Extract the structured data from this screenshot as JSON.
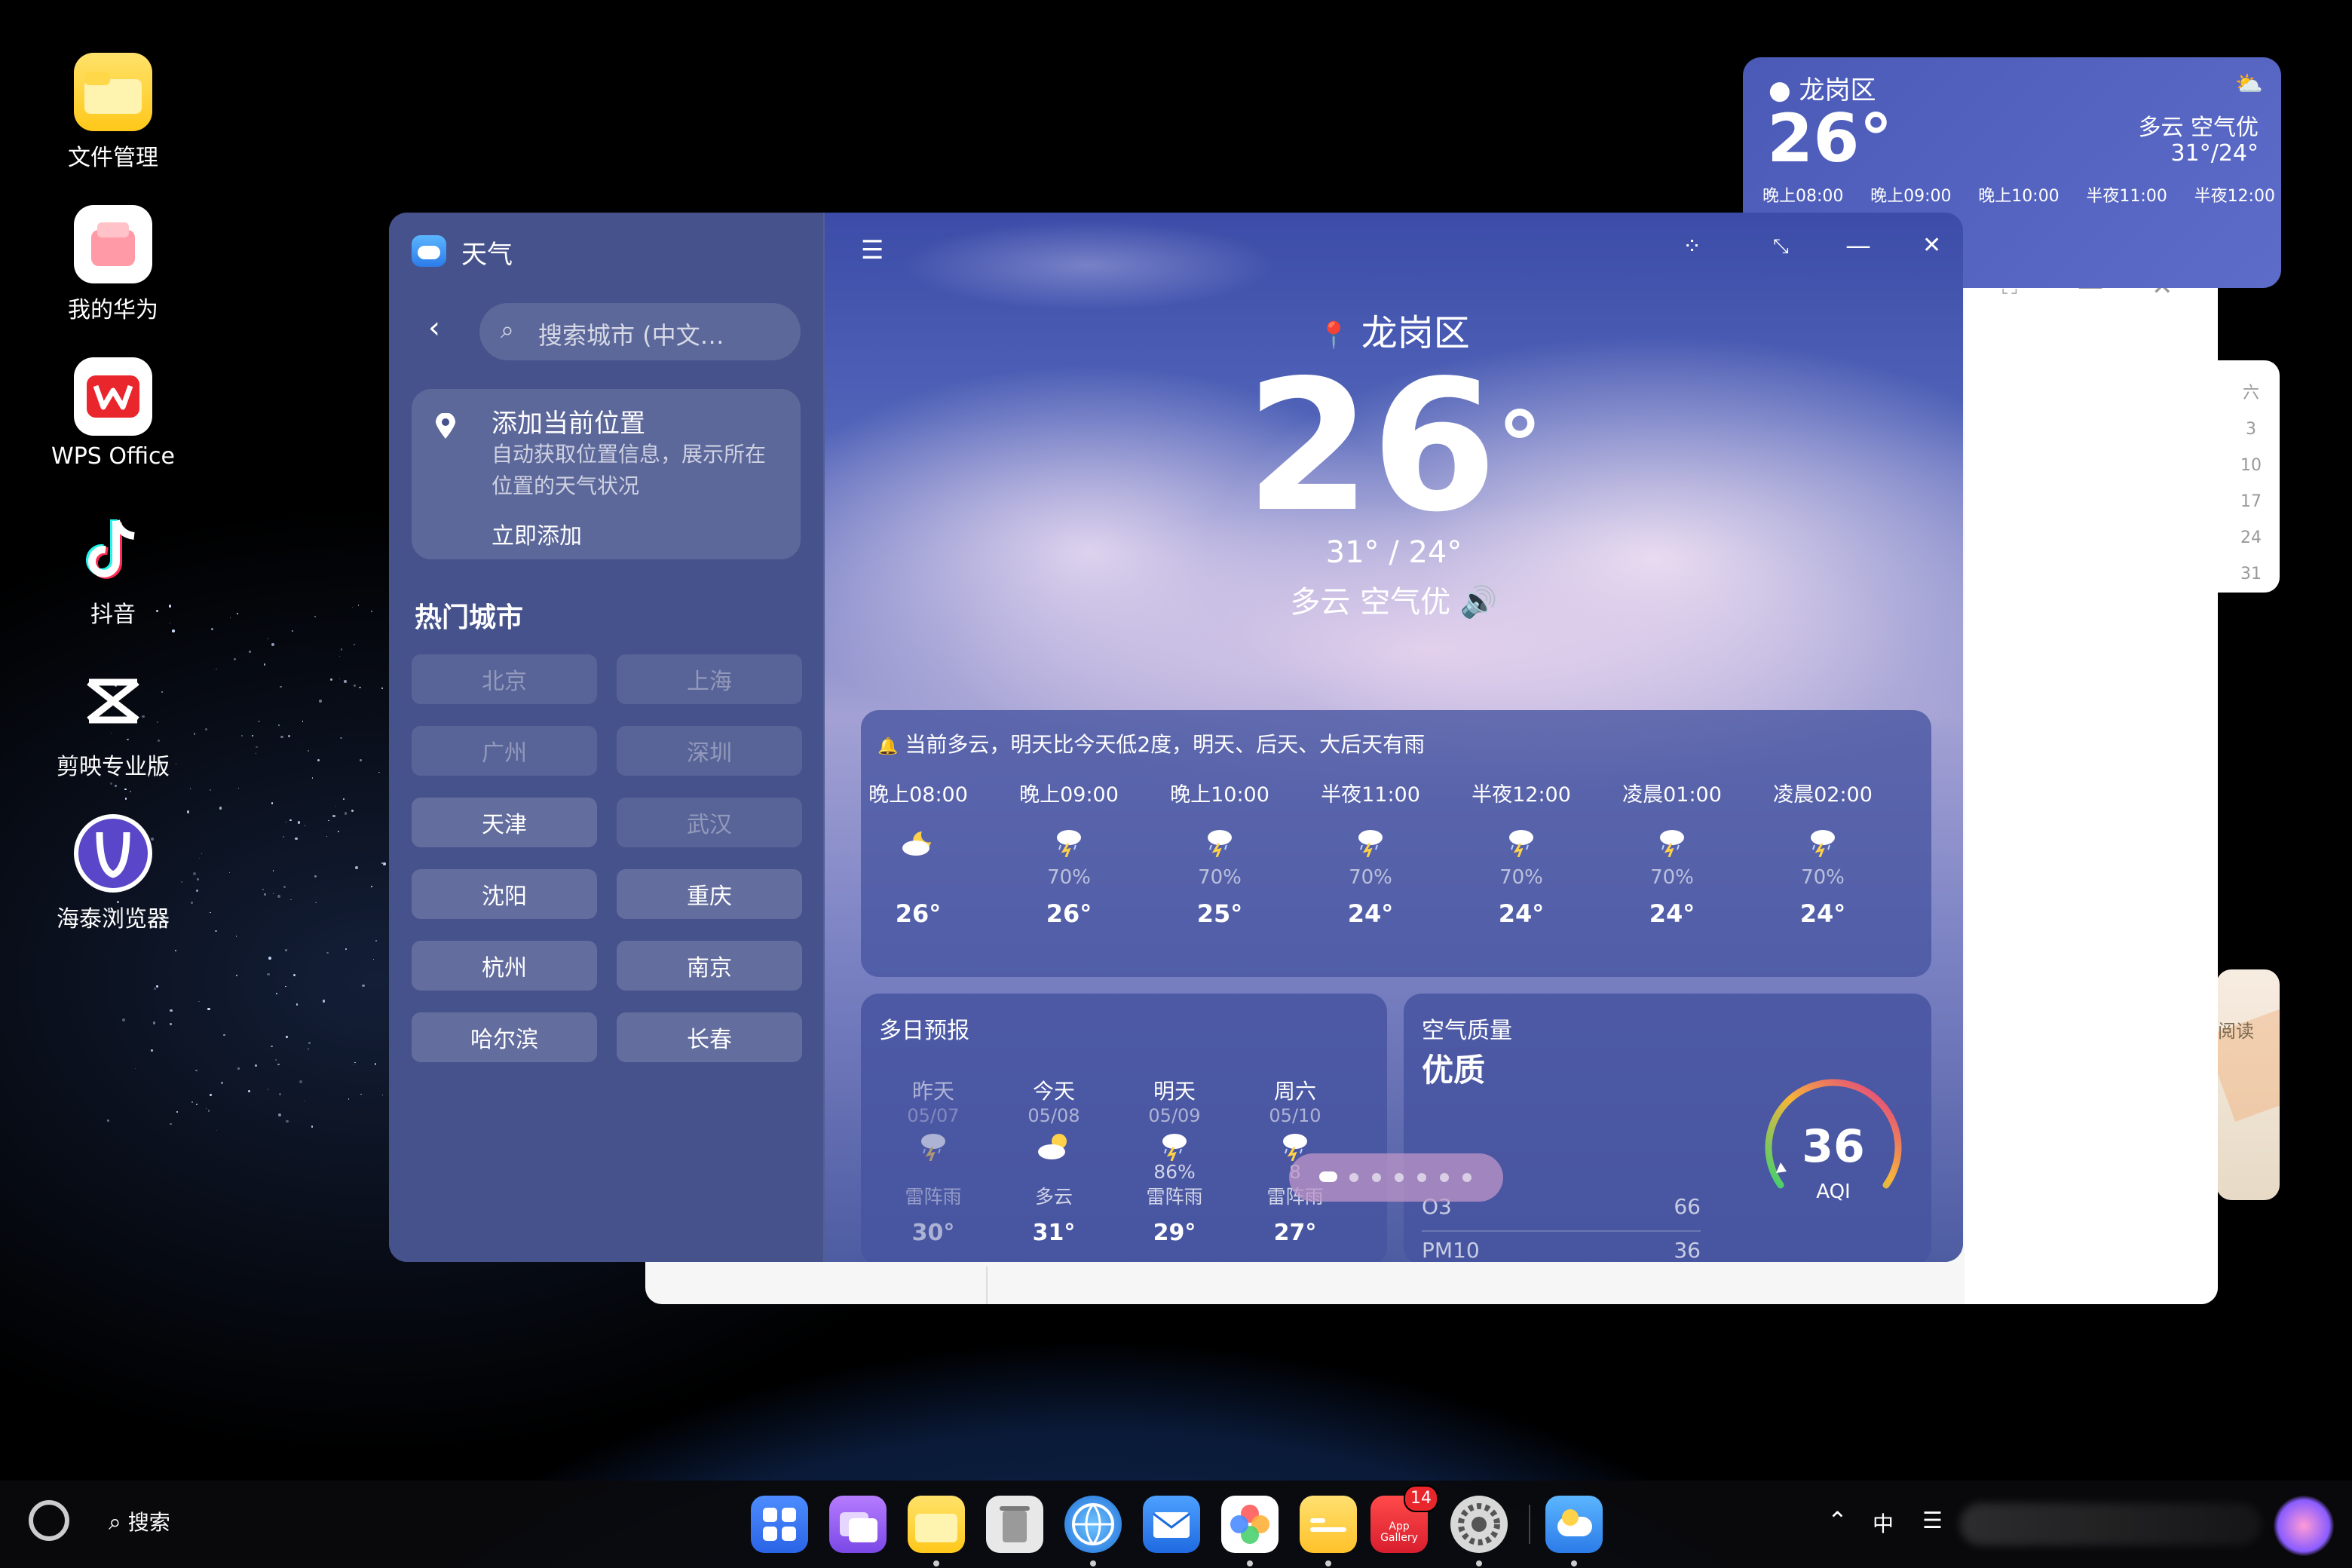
{
  "desktop": {
    "icons": [
      {
        "label": "文件管理",
        "icon": "folder-icon"
      },
      {
        "label": "我的华为",
        "icon": "huawei-bag-icon"
      },
      {
        "label": "WPS Office",
        "icon": "wps-icon"
      },
      {
        "label": "抖音",
        "icon": "douyin-icon"
      },
      {
        "label": "剪映专业版",
        "icon": "capcut-icon"
      },
      {
        "label": "海泰浏览器",
        "icon": "browser-icon"
      }
    ]
  },
  "widget": {
    "location": "龙岗区",
    "temp": "26°",
    "condition": "多云  空气优",
    "range": "31°/24°",
    "hours": [
      "晚上08:00",
      "晚上09:00",
      "晚上10:00",
      "半夜11:00",
      "半夜12:00"
    ]
  },
  "calendar_partial": {
    "days": [
      "六",
      "3",
      "10",
      "17",
      "24",
      "31"
    ]
  },
  "reading_partial": {
    "text": "阅读"
  },
  "weather_app": {
    "title": "天气",
    "search_placeholder": "搜索城市 (中文…",
    "add_location": {
      "title": "添加当前位置",
      "desc": "自动获取位置信息，展示所在位置的天气状况",
      "action": "立即添加"
    },
    "hot_cities_title": "热门城市",
    "hot_cities": [
      {
        "name": "北京",
        "added": true
      },
      {
        "name": "上海",
        "added": true
      },
      {
        "name": "广州",
        "added": true
      },
      {
        "name": "深圳",
        "added": true
      },
      {
        "name": "天津",
        "added": false
      },
      {
        "name": "武汉",
        "added": true
      },
      {
        "name": "沈阳",
        "added": false
      },
      {
        "name": "重庆",
        "added": false
      },
      {
        "name": "杭州",
        "added": false
      },
      {
        "name": "南京",
        "added": false
      },
      {
        "name": "哈尔滨",
        "added": false
      },
      {
        "name": "长春",
        "added": false
      }
    ],
    "location": "龙岗区",
    "current_temp": "26",
    "degree": "°",
    "range": "31° / 24°",
    "condition": "多云  空气优",
    "alert": "当前多云，明天比今天低2度，明天、后天、大后天有雨",
    "hourly": [
      {
        "time": "晚上08:00",
        "icon": "cloudy-night-icon",
        "precip": "",
        "temp": "26°"
      },
      {
        "time": "晚上09:00",
        "icon": "thunder-rain-icon",
        "precip": "70%",
        "temp": "26°"
      },
      {
        "time": "晚上10:00",
        "icon": "thunder-rain-icon",
        "precip": "70%",
        "temp": "25°"
      },
      {
        "time": "半夜11:00",
        "icon": "thunder-rain-icon",
        "precip": "70%",
        "temp": "24°"
      },
      {
        "time": "半夜12:00",
        "icon": "thunder-rain-icon",
        "precip": "70%",
        "temp": "24°"
      },
      {
        "time": "凌晨01:00",
        "icon": "thunder-rain-icon",
        "precip": "70%",
        "temp": "24°"
      },
      {
        "time": "凌晨02:00",
        "icon": "thunder-rain-icon",
        "precip": "70%",
        "temp": "24°"
      }
    ],
    "forecast_title": "多日预报",
    "forecast": [
      {
        "day": "昨天",
        "date": "05/07",
        "precip": "",
        "weather": "雷阵雨",
        "temp": "30°",
        "icon": "thunder-rain-icon",
        "past": true
      },
      {
        "day": "今天",
        "date": "05/08",
        "precip": "",
        "weather": "多云",
        "temp": "31°",
        "icon": "partly-cloudy-icon",
        "past": false
      },
      {
        "day": "明天",
        "date": "05/09",
        "precip": "86%",
        "weather": "雷阵雨",
        "temp": "29°",
        "icon": "thunder-rain-icon",
        "past": false
      },
      {
        "day": "周六",
        "date": "05/10",
        "precip": "8",
        "weather": "雷阵雨",
        "temp": "27°",
        "icon": "thunder-rain-icon",
        "past": false
      }
    ],
    "aqi_title": "空气质量",
    "aqi_level": "优质",
    "aqi_value": "36",
    "aqi_unit": "AQI",
    "pollutants": [
      {
        "name": "O3",
        "value": "66"
      },
      {
        "name": "PM10",
        "value": "36"
      }
    ]
  },
  "taskbar": {
    "search_label": "搜索",
    "badge": "14",
    "appgallery_label": "App Gallery",
    "ime": "中",
    "apps": [
      "grid-icon",
      "multiwindow-icon",
      "folder-icon",
      "trash-icon",
      "browser-icon",
      "mail-icon",
      "photos-icon",
      "notes-icon",
      "appgallery-icon",
      "settings-icon",
      "weather-icon"
    ]
  },
  "colors": {
    "panel": "#4b5897",
    "sidebar": "#44518a",
    "accent_aqi_start": "#3ed16f",
    "accent_aqi_end": "#e0318c"
  }
}
